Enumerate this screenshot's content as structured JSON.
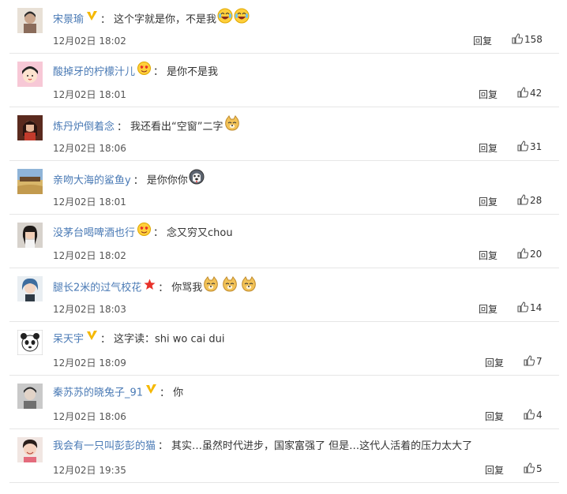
{
  "comments": [
    {
      "user": "宋景瑜",
      "badge": "vip-v",
      "text": "这个字就是你，不是我",
      "emojis": [
        "laugh-cry-emoji",
        "laugh-cry-emoji"
      ],
      "time": "12月02日 18:02",
      "reply": "回复",
      "likes": "158",
      "avatar_icon": "user-avatar-icon"
    },
    {
      "user": "酸掉牙的柠檬汁儿",
      "badge": "heart-eyes",
      "text": "是你不是我",
      "emojis": [],
      "time": "12月02日 18:01",
      "reply": "回复",
      "likes": "42",
      "avatar_icon": "cartoon-avatar-icon"
    },
    {
      "user": "炼丹炉倒着念",
      "badge": "",
      "text": "我还看出“空窗”二字",
      "emojis": [
        "doge-emoji"
      ],
      "time": "12月02日 18:06",
      "reply": "回复",
      "likes": "31",
      "avatar_icon": "user-avatar-icon"
    },
    {
      "user": "亲吻大海的鲨鱼y",
      "badge": "",
      "text": "是你你你",
      "emojis": [
        "husky-emoji"
      ],
      "time": "12月02日 18:01",
      "reply": "回复",
      "likes": "28",
      "avatar_icon": "landscape-avatar-icon"
    },
    {
      "user": "没茅台喝啤酒也行",
      "badge": "heart-eyes",
      "text": "念又穷又chou",
      "emojis": [],
      "time": "12月02日 18:02",
      "reply": "回复",
      "likes": "20",
      "avatar_icon": "user-avatar-icon"
    },
    {
      "user": "腿长2米的过气校花",
      "badge": "star",
      "text": "你骂我",
      "emojis": [
        "doge-emoji",
        "doge-emoji",
        "doge-emoji"
      ],
      "time": "12月02日 18:03",
      "reply": "回复",
      "likes": "14",
      "avatar_icon": "user-avatar-icon"
    },
    {
      "user": "呆天宇",
      "badge": "vip-v",
      "text": "这字读：shi wo cai dui",
      "emojis": [],
      "time": "12月02日 18:09",
      "reply": "回复",
      "likes": "7",
      "avatar_icon": "panda-avatar-icon"
    },
    {
      "user": "秦苏苏的晓兔子_91",
      "badge": "vip-v",
      "text": "你",
      "emojis": [],
      "time": "12月02日 18:06",
      "reply": "回复",
      "likes": "4",
      "avatar_icon": "user-avatar-icon"
    },
    {
      "user": "我会有一只叫彭彭的猫",
      "badge": "",
      "text": "其实…虽然时代进步，国家富强了 但是…这代人活着的压力太大了",
      "emojis": [],
      "time": "12月02日 19:35",
      "reply": "回复",
      "likes": "5",
      "avatar_icon": "user-avatar-icon"
    }
  ],
  "colors": {
    "username": "#4a7ab5",
    "text": "#333333",
    "divider": "#e6e6e6",
    "badge_v": "#f5b800"
  }
}
